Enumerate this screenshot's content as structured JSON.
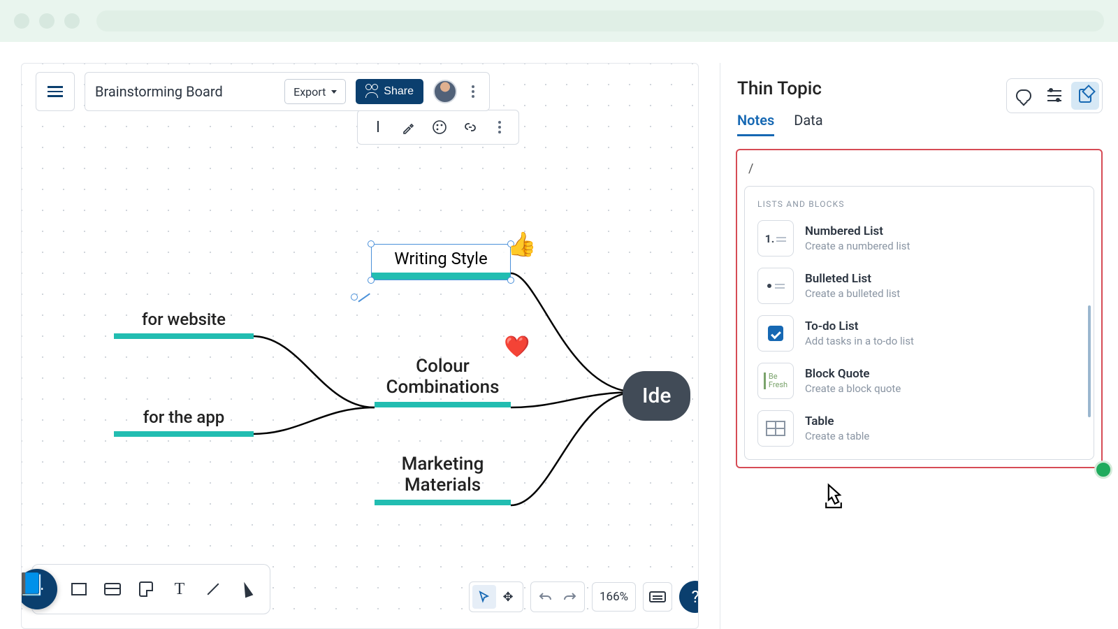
{
  "board": {
    "title": "Brainstorming Board",
    "export_label": "Export",
    "share_label": "Share"
  },
  "mindmap": {
    "central": "Ide",
    "selected": "Writing Style",
    "colour": "Colour\nCombinations",
    "marketing": "Marketing\nMaterials",
    "website": "for website",
    "app": "for the app"
  },
  "view": {
    "zoom": "166%"
  },
  "side_panel": {
    "title": "Thin Topic",
    "tabs": {
      "notes": "Notes",
      "data": "Data"
    },
    "slash": "/",
    "section_label": "LISTS AND BLOCKS",
    "items": [
      {
        "title": "Numbered List",
        "sub": "Create a numbered list"
      },
      {
        "title": "Bulleted List",
        "sub": "Create a bulleted list"
      },
      {
        "title": "To-do List",
        "sub": "Add tasks in a to-do list"
      },
      {
        "title": "Block Quote",
        "sub": "Create a block quote"
      },
      {
        "title": "Table",
        "sub": "Create a table"
      }
    ],
    "quote_sample": "Be\nFresh"
  }
}
